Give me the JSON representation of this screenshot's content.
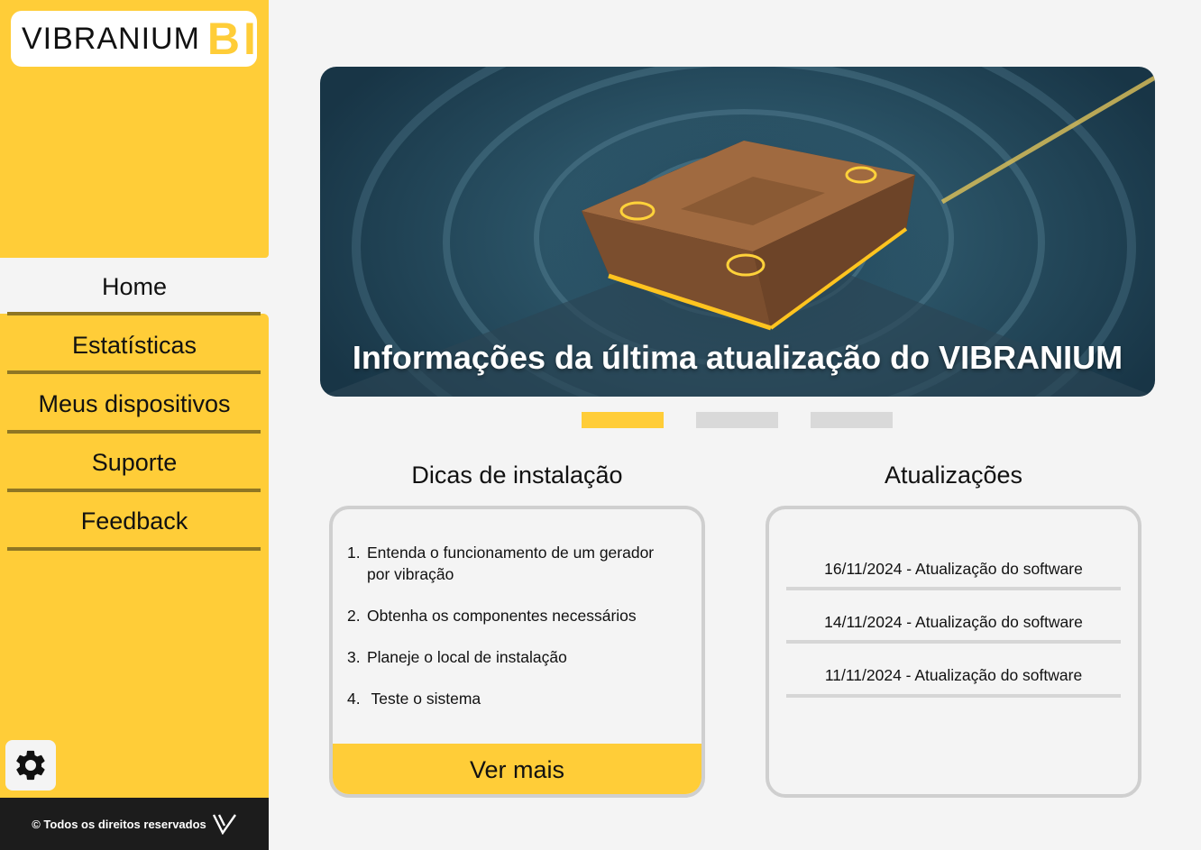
{
  "brand": {
    "name": "VIBRANIUM",
    "suffix": "BI"
  },
  "sidebar": {
    "items": [
      {
        "label": "Home",
        "active": true
      },
      {
        "label": "Estatísticas",
        "active": false
      },
      {
        "label": "Meus dispositivos",
        "active": false
      },
      {
        "label": "Suporte",
        "active": false
      },
      {
        "label": "Feedback",
        "active": false
      }
    ],
    "settings_icon": "gear-icon"
  },
  "footer": {
    "copyright": "© Todos os direitos reservados",
    "logo_icon": "v-logo-icon"
  },
  "banner": {
    "title": "Informações da última atualização do VIBRANIUM",
    "slides_count": 3,
    "active_slide": 1
  },
  "tips": {
    "title": "Dicas de instalação",
    "items": [
      {
        "num": "1.",
        "text": "Entenda o funcionamento de um gerador por vibração"
      },
      {
        "num": "2.",
        "text": "Obtenha os componentes necessários"
      },
      {
        "num": "3.",
        "text": "Planeje o local de instalação"
      },
      {
        "num": "4.",
        "text": " Teste o sistema"
      }
    ],
    "more_label": "Ver mais"
  },
  "updates": {
    "title": "Atualizações",
    "items": [
      "16/11/2024 - Atualização do software",
      "14/11/2024 - Atualização do software",
      "11/11/2024 - Atualização do software"
    ]
  },
  "colors": {
    "accent": "#ffcd38",
    "nav_divider": "#8f7623",
    "footer_bg": "#1c1c1c",
    "background": "#f4f4f4"
  }
}
